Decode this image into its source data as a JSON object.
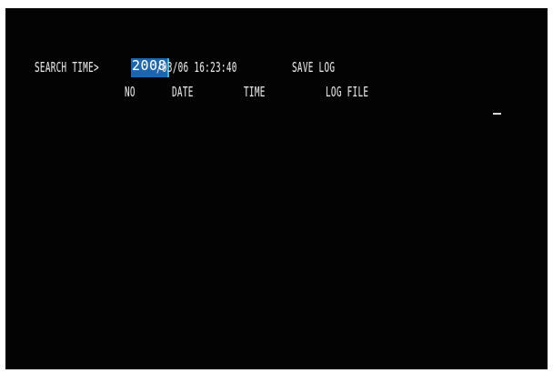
{
  "search": {
    "label": "SEARCH TIME>",
    "year": "2008",
    "datetime_rest": "/03/06 16:23:40",
    "save_label": "SAVE LOG"
  },
  "columns": {
    "no": "NO",
    "date": "DATE",
    "time": "TIME",
    "log_file": "LOG FILE"
  },
  "colors": {
    "background": "#030303",
    "text": "#e2e2e2",
    "highlight": "#1c66b0"
  }
}
